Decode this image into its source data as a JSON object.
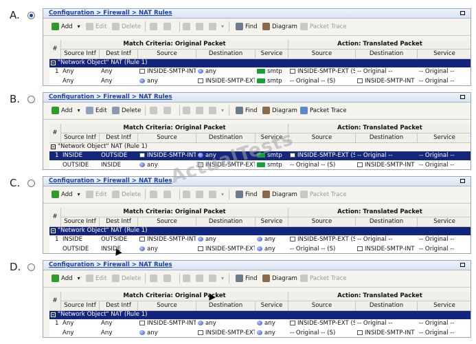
{
  "options": [
    {
      "letter": "A.",
      "selected": true,
      "breadcrumb": "Configuration > Firewall > NAT Rules",
      "toolbar": {
        "add": "Add",
        "edit": "Edit",
        "delete": "Delete",
        "find": "Find",
        "diagram": "Diagram",
        "packet_trace": "Packet Trace",
        "edit_enabled": false,
        "delete_enabled": false,
        "packet_trace_enabled": false
      },
      "headers": {
        "num": "#",
        "match": "Match Criteria: Original Packet",
        "action": "Action: Translated Packet",
        "cols": [
          "Source Intf",
          "Dest Intf",
          "Source",
          "Destination",
          "Service",
          "Source",
          "Destination",
          "Service"
        ]
      },
      "group": {
        "label": "\"Network Object\" NAT (Rule 1)",
        "style": "dark"
      },
      "rows": [
        {
          "num": "1",
          "src_intf": "Any",
          "dst_intf": "Any",
          "source": "INSIDE-SMTP-INT",
          "source_icon": "object",
          "destination": "any",
          "destination_icon": "any",
          "service": "smtp",
          "service_icon": "service",
          "t_source": "INSIDE-SMTP-EXT (S)",
          "t_source_icon": "object",
          "t_destination": "-- Original --",
          "t_destination_icon": "none",
          "t_service": "-- Original --",
          "selected": false
        },
        {
          "num": "",
          "src_intf": "Any",
          "dst_intf": "Any",
          "source": "any",
          "source_icon": "any",
          "destination": "INSIDE-SMTP-EXT",
          "destination_icon": "object",
          "service": "smtp",
          "service_icon": "service",
          "t_source": "-- Original -- (S)",
          "t_source_icon": "none",
          "t_destination": "INSIDE-SMTP-INT",
          "t_destination_icon": "object",
          "t_service": "-- Original --",
          "selected": false
        }
      ]
    },
    {
      "letter": "B.",
      "selected": false,
      "breadcrumb": "Configuration > Firewall > NAT Rules",
      "toolbar": {
        "add": "Add",
        "edit": "Edit",
        "delete": "Delete",
        "find": "Find",
        "diagram": "Diagram",
        "packet_trace": "Packet Trace",
        "edit_enabled": true,
        "delete_enabled": true,
        "packet_trace_enabled": true
      },
      "headers": {
        "num": "#",
        "match": "Match Criteria: Original Packet",
        "action": "Action: Translated Packet",
        "cols": [
          "Source Intf",
          "Dest Intf",
          "Source",
          "Destination",
          "Service",
          "Source",
          "Destination",
          "Service"
        ]
      },
      "group": {
        "label": "\"Network Object\" NAT (Rule 1)",
        "style": "light"
      },
      "rows": [
        {
          "num": "1",
          "src_intf": "INSIDE",
          "dst_intf": "OUTSIDE",
          "source": "INSIDE-SMTP-INT",
          "source_icon": "object",
          "destination": "any",
          "destination_icon": "any",
          "service": "smtp",
          "service_icon": "service",
          "t_source": "INSIDE-SMTP-EXT (S)",
          "t_source_icon": "object",
          "t_destination": "-- Original --",
          "t_destination_icon": "none",
          "t_service": "-- Original --",
          "selected": true
        },
        {
          "num": "",
          "src_intf": "OUTSIDE",
          "dst_intf": "INSIDE",
          "source": "any",
          "source_icon": "any",
          "destination": "INSIDE-SMTP-EXT",
          "destination_icon": "object",
          "service": "smtp",
          "service_icon": "service",
          "t_source": "-- Original -- (S)",
          "t_source_icon": "none",
          "t_destination": "INSIDE-SMTP-INT",
          "t_destination_icon": "object",
          "t_service": "-- Original --",
          "selected": false
        }
      ]
    },
    {
      "letter": "C.",
      "selected": false,
      "breadcrumb": "Configuration > Firewall > NAT Rules",
      "toolbar": {
        "add": "Add",
        "edit": "Edit",
        "delete": "Delete",
        "find": "Find",
        "diagram": "Diagram",
        "packet_trace": "Packet Trace",
        "edit_enabled": false,
        "delete_enabled": false,
        "packet_trace_enabled": false
      },
      "headers": {
        "num": "#",
        "match": "Match Criteria: Original Packet",
        "action": "Action: Translated Packet",
        "cols": [
          "Source Intf",
          "Dest Intf",
          "Source",
          "Destination",
          "Service",
          "Source",
          "Destination",
          "Service"
        ]
      },
      "group": {
        "label": "\"Network Object\" NAT (Rule 1)",
        "style": "dark"
      },
      "rows": [
        {
          "num": "1",
          "src_intf": "INSIDE",
          "dst_intf": "OUTSIDE",
          "source": "INSIDE-SMTP-INT",
          "source_icon": "object",
          "destination": "any",
          "destination_icon": "any",
          "service": "any",
          "service_icon": "any",
          "t_source": "INSIDE-SMTP-EXT (S)",
          "t_source_icon": "object",
          "t_destination": "-- Original --",
          "t_destination_icon": "none",
          "t_service": "-- Original --",
          "selected": false
        },
        {
          "num": "",
          "src_intf": "OUTSIDE",
          "dst_intf": "INSIDE",
          "source": "any",
          "source_icon": "any",
          "destination": "INSIDE-SMTP-EXT",
          "destination_icon": "object",
          "service": "any",
          "service_icon": "any",
          "t_source": "-- Original -- (S)",
          "t_source_icon": "none",
          "t_destination": "INSIDE-SMTP-INT",
          "t_destination_icon": "object",
          "t_service": "-- Original --",
          "selected": false
        }
      ]
    },
    {
      "letter": "D.",
      "selected": false,
      "breadcrumb": "Configuration > Firewall > NAT Rules",
      "toolbar": {
        "add": "Add",
        "edit": "Edit",
        "delete": "Delete",
        "find": "Find",
        "diagram": "Diagram",
        "packet_trace": "Packet Trace",
        "edit_enabled": false,
        "delete_enabled": false,
        "packet_trace_enabled": false
      },
      "headers": {
        "num": "#",
        "match": "Match Criteria: Original Packet",
        "action": "Action: Translated Packet",
        "cols": [
          "Source Intf",
          "Dest Intf",
          "Source",
          "Destination",
          "Service",
          "Source",
          "Destination",
          "Service"
        ]
      },
      "group": {
        "label": "\"Network Object\" NAT (Rule 1)",
        "style": "dark"
      },
      "rows": [
        {
          "num": "1",
          "src_intf": "Any",
          "dst_intf": "Any",
          "source": "INSIDE-SMTP-INT",
          "source_icon": "object",
          "destination": "any",
          "destination_icon": "any",
          "service": "any",
          "service_icon": "any",
          "t_source": "INSIDE-SMTP-EXT (S)",
          "t_source_icon": "object",
          "t_destination": "-- Original --",
          "t_destination_icon": "none",
          "t_service": "-- Original --",
          "selected": false
        },
        {
          "num": "",
          "src_intf": "Any",
          "dst_intf": "Any",
          "source": "any",
          "source_icon": "any",
          "destination": "INSIDE-SMTP-EXT",
          "destination_icon": "object",
          "service": "any",
          "service_icon": "any",
          "t_source": "-- Original -- (S)",
          "t_source_icon": "none",
          "t_destination": "INSIDE-SMTP-INT",
          "t_destination_icon": "object",
          "t_service": "-- Original --",
          "selected": false
        }
      ]
    }
  ],
  "watermark": "ActualTests",
  "colors": {
    "selection": "#15277a",
    "group_dark": "#12247c",
    "link": "#1a3fae",
    "service_green": "#18a03a"
  }
}
